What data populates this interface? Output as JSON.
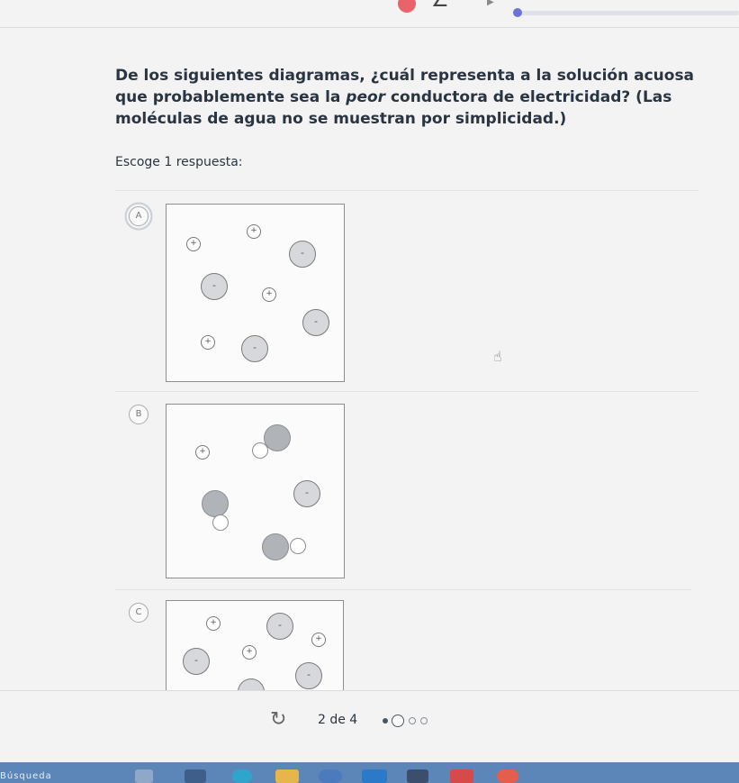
{
  "question": {
    "before": "De los siguientes diagramas, ¿cuál representa a la solución acuosa que probablemente sea la ",
    "emphasis": "peor",
    "after": " conductora de electricidad? (Las moléculas de agua no se muestran por simplicidad.)"
  },
  "prompt": "Escoge 1 respuesta:",
  "options": [
    {
      "letter": "A",
      "selected": true
    },
    {
      "letter": "B",
      "selected": false
    },
    {
      "letter": "C",
      "selected": false
    }
  ],
  "charges": {
    "plus": "+",
    "minus": "-"
  },
  "pagination": {
    "counter": "2 de 4",
    "current": 2,
    "total": 4
  },
  "taskbar_label": "Búsqueda",
  "icons": [
    "reload-icon",
    "pointer-hand-icon",
    "search-icon"
  ],
  "colors": {
    "accent": "#6a73d8",
    "taskbar": "#5c86b8",
    "anion_fill": "#d6d8db",
    "molecule_fill": "#b0b3b7"
  }
}
